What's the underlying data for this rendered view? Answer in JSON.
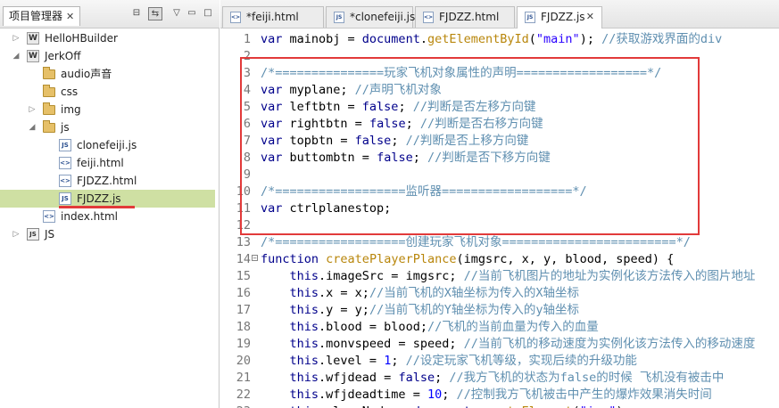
{
  "project_panel": {
    "title": "项目管理器",
    "close": "✕",
    "tree": [
      {
        "label": "HelloHBuilder",
        "icon": "project-icon",
        "twisty": "▷",
        "indent": 0
      },
      {
        "label": "JerkOff",
        "icon": "project-icon",
        "twisty": "◢",
        "indent": 0
      },
      {
        "label": "audio声音",
        "icon": "folder-icon",
        "twisty": "",
        "indent": 1
      },
      {
        "label": "css",
        "icon": "folder-icon",
        "twisty": "",
        "indent": 1
      },
      {
        "label": "img",
        "icon": "folder-icon",
        "twisty": "▷",
        "indent": 1
      },
      {
        "label": "js",
        "icon": "folder-icon",
        "twisty": "◢",
        "indent": 1
      },
      {
        "label": "clonefeiji.js",
        "icon": "js-file-icon",
        "twisty": "",
        "indent": 2
      },
      {
        "label": "feiji.html",
        "icon": "html-file-icon",
        "twisty": "",
        "indent": 2
      },
      {
        "label": "FJDZZ.html",
        "icon": "html-file-icon",
        "twisty": "",
        "indent": 2
      },
      {
        "label": "FJDZZ.js",
        "icon": "js-file-icon",
        "twisty": "",
        "indent": 2,
        "selected": true
      },
      {
        "label": "index.html",
        "icon": "html-file-icon",
        "twisty": "",
        "indent": 1
      },
      {
        "label": "JS",
        "icon": "library-icon",
        "twisty": "▷",
        "indent": 0
      }
    ]
  },
  "editor": {
    "tabs": [
      {
        "label": "*feiji.html",
        "active": false
      },
      {
        "label": "*clonefeiji.js",
        "active": false
      },
      {
        "label": "FJDZZ.html",
        "active": false
      },
      {
        "label": "FJDZZ.js",
        "active": true,
        "close": "✕"
      }
    ],
    "lines": [
      {
        "n": "1",
        "t": [
          [
            "kw",
            "var"
          ],
          [
            "p",
            " mainobj = "
          ],
          [
            "ob",
            "document"
          ],
          [
            "p",
            "."
          ],
          [
            "fn",
            "getElementById"
          ],
          [
            "p",
            "("
          ],
          [
            "str",
            "\"main\""
          ],
          [
            "p",
            "); "
          ],
          [
            "cm",
            "//获取游戏界面的div"
          ]
        ]
      },
      {
        "n": "2",
        "t": []
      },
      {
        "n": "3",
        "t": [
          [
            "cm",
            "/*===============玩家飞机对象属性的声明==================*/"
          ]
        ]
      },
      {
        "n": "4",
        "t": [
          [
            "kw",
            "var"
          ],
          [
            "p",
            " myplane; "
          ],
          [
            "cm",
            "//声明飞机对象"
          ]
        ]
      },
      {
        "n": "5",
        "t": [
          [
            "kw",
            "var"
          ],
          [
            "p",
            " leftbtn = "
          ],
          [
            "kw",
            "false"
          ],
          [
            "p",
            "; "
          ],
          [
            "cm",
            "//判断是否左移方向键"
          ]
        ]
      },
      {
        "n": "6",
        "t": [
          [
            "kw",
            "var"
          ],
          [
            "p",
            " rightbtn = "
          ],
          [
            "kw",
            "false"
          ],
          [
            "p",
            "; "
          ],
          [
            "cm",
            "//判断是否右移方向键"
          ]
        ]
      },
      {
        "n": "7",
        "t": [
          [
            "kw",
            "var"
          ],
          [
            "p",
            " topbtn = "
          ],
          [
            "kw",
            "false"
          ],
          [
            "p",
            "; "
          ],
          [
            "cm",
            "//判断是否上移方向键"
          ]
        ]
      },
      {
        "n": "8",
        "t": [
          [
            "kw",
            "var"
          ],
          [
            "p",
            " buttombtn = "
          ],
          [
            "kw",
            "false"
          ],
          [
            "p",
            "; "
          ],
          [
            "cm",
            "//判断是否下移方向键"
          ]
        ]
      },
      {
        "n": "9",
        "t": []
      },
      {
        "n": "10",
        "t": [
          [
            "cm",
            "/*==================监听器==================*/"
          ]
        ]
      },
      {
        "n": "11",
        "t": [
          [
            "kw",
            "var"
          ],
          [
            "p",
            " ctrlplanestop;"
          ]
        ]
      },
      {
        "n": "12",
        "t": []
      },
      {
        "n": "13",
        "t": [
          [
            "cm",
            "/*==================创建玩家飞机对象========================*/"
          ]
        ]
      },
      {
        "n": "14",
        "fold": "−",
        "t": [
          [
            "kw",
            "function"
          ],
          [
            "p",
            " "
          ],
          [
            "fn",
            "createPlayerPlance"
          ],
          [
            "p",
            "(imgsrc, x, y, blood, speed) {"
          ]
        ]
      },
      {
        "n": "15",
        "t": [
          [
            "p",
            "    "
          ],
          [
            "kw",
            "this"
          ],
          [
            "p",
            ".imageSrc = imgsrc; "
          ],
          [
            "cm",
            "//当前飞机图片的地址为实例化该方法传入的图片地址"
          ]
        ]
      },
      {
        "n": "16",
        "t": [
          [
            "p",
            "    "
          ],
          [
            "kw",
            "this"
          ],
          [
            "p",
            ".x = x;"
          ],
          [
            "cm",
            "//当前飞机的X轴坐标为传入的X轴坐标"
          ]
        ]
      },
      {
        "n": "17",
        "t": [
          [
            "p",
            "    "
          ],
          [
            "kw",
            "this"
          ],
          [
            "p",
            ".y = y;"
          ],
          [
            "cm",
            "//当前飞机的Y轴坐标为传入的y轴坐标"
          ]
        ]
      },
      {
        "n": "18",
        "t": [
          [
            "p",
            "    "
          ],
          [
            "kw",
            "this"
          ],
          [
            "p",
            ".blood = blood;"
          ],
          [
            "cm",
            "//飞机的当前血量为传入的血量"
          ]
        ]
      },
      {
        "n": "19",
        "t": [
          [
            "p",
            "    "
          ],
          [
            "kw",
            "this"
          ],
          [
            "p",
            ".monvspeed = speed; "
          ],
          [
            "cm",
            "//当前飞机的移动速度为实例化该方法传入的移动速度"
          ]
        ]
      },
      {
        "n": "20",
        "t": [
          [
            "p",
            "    "
          ],
          [
            "kw",
            "this"
          ],
          [
            "p",
            ".level = "
          ],
          [
            "num",
            "1"
          ],
          [
            "p",
            "; "
          ],
          [
            "cm",
            "//设定玩家飞机等级，实现后续的升级功能"
          ]
        ]
      },
      {
        "n": "21",
        "t": [
          [
            "p",
            "    "
          ],
          [
            "kw",
            "this"
          ],
          [
            "p",
            ".wfjdead = "
          ],
          [
            "kw",
            "false"
          ],
          [
            "p",
            "; "
          ],
          [
            "cm",
            "//我方飞机的状态为false的时候 飞机没有被击中"
          ]
        ]
      },
      {
        "n": "22",
        "t": [
          [
            "p",
            "    "
          ],
          [
            "kw",
            "this"
          ],
          [
            "p",
            ".wfjdeadtime = "
          ],
          [
            "num",
            "10"
          ],
          [
            "p",
            "; "
          ],
          [
            "cm",
            "//控制我方飞机被击中产生的爆炸效果消失时间"
          ]
        ]
      },
      {
        "n": "23",
        "t": [
          [
            "p",
            "    "
          ],
          [
            "kw",
            "this"
          ],
          [
            "p",
            ".planeNode = "
          ],
          [
            "ob",
            "document"
          ],
          [
            "p",
            "."
          ],
          [
            "fn",
            "createElement"
          ],
          [
            "p",
            "("
          ],
          [
            "str",
            "\"img\""
          ],
          [
            "p",
            ");"
          ]
        ]
      }
    ]
  }
}
